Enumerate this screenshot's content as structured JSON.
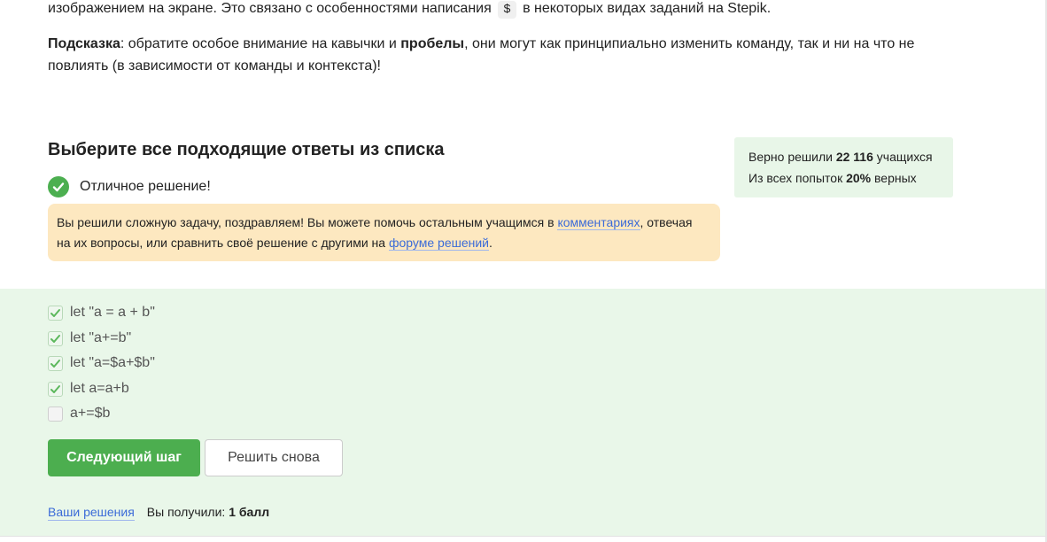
{
  "intro": {
    "line1_before": "изображением на экране. Это связано с особенностями написания",
    "line1_code": "$",
    "line1_after": "в некоторых видах заданий на Stepik.",
    "hint_label": "Подсказка",
    "hint_part1": ": обратите особое внимание на кавычки и",
    "hint_bold": "пробелы",
    "hint_part2": ", они могут как принципиально изменить команду, так и ни на что не",
    "hint_line2": "повлиять (в зависимости от команды и контекста)!"
  },
  "quiz": {
    "title": "Выберите все подходящие ответы из списка",
    "status_text": "Отличное решение!"
  },
  "congrats": {
    "text1": "Вы решили сложную задачу, поздравляем! Вы можете помочь остальным учащимся в",
    "link_comments": "комментариях",
    "text2": ", отвечая",
    "text3": "на их вопросы, или сравнить своё решение с другими на",
    "link_forum": "форуме решений",
    "text4": "."
  },
  "stats": {
    "solved_prefix": "Верно решили",
    "solved_count": "22 116",
    "solved_suffix": "учащихся",
    "attempts_prefix": "Из всех попыток",
    "attempts_percent": "20%",
    "attempts_suffix": "верных"
  },
  "options": [
    {
      "label": "let \"a = a + b\"",
      "checked": true
    },
    {
      "label": "let \"a+=b\"",
      "checked": true
    },
    {
      "label": "let \"a=$a+$b\"",
      "checked": true
    },
    {
      "label": "let a=a+b",
      "checked": true
    },
    {
      "label": "a+=$b",
      "checked": false
    }
  ],
  "buttons": {
    "next": "Следующий шаг",
    "retry": "Решить снова"
  },
  "footer": {
    "solutions_link": "Ваши решения",
    "score_label": "Вы получили:",
    "score_value": "1 балл"
  },
  "colors": {
    "accent_green": "#4cae4f",
    "answers_bg": "#e9f7e9",
    "congrats_bg": "#fde8c0",
    "link": "#3b6bd8"
  },
  "icons": {
    "status": "check-circle-icon",
    "option_checked": "checkmark-icon"
  }
}
